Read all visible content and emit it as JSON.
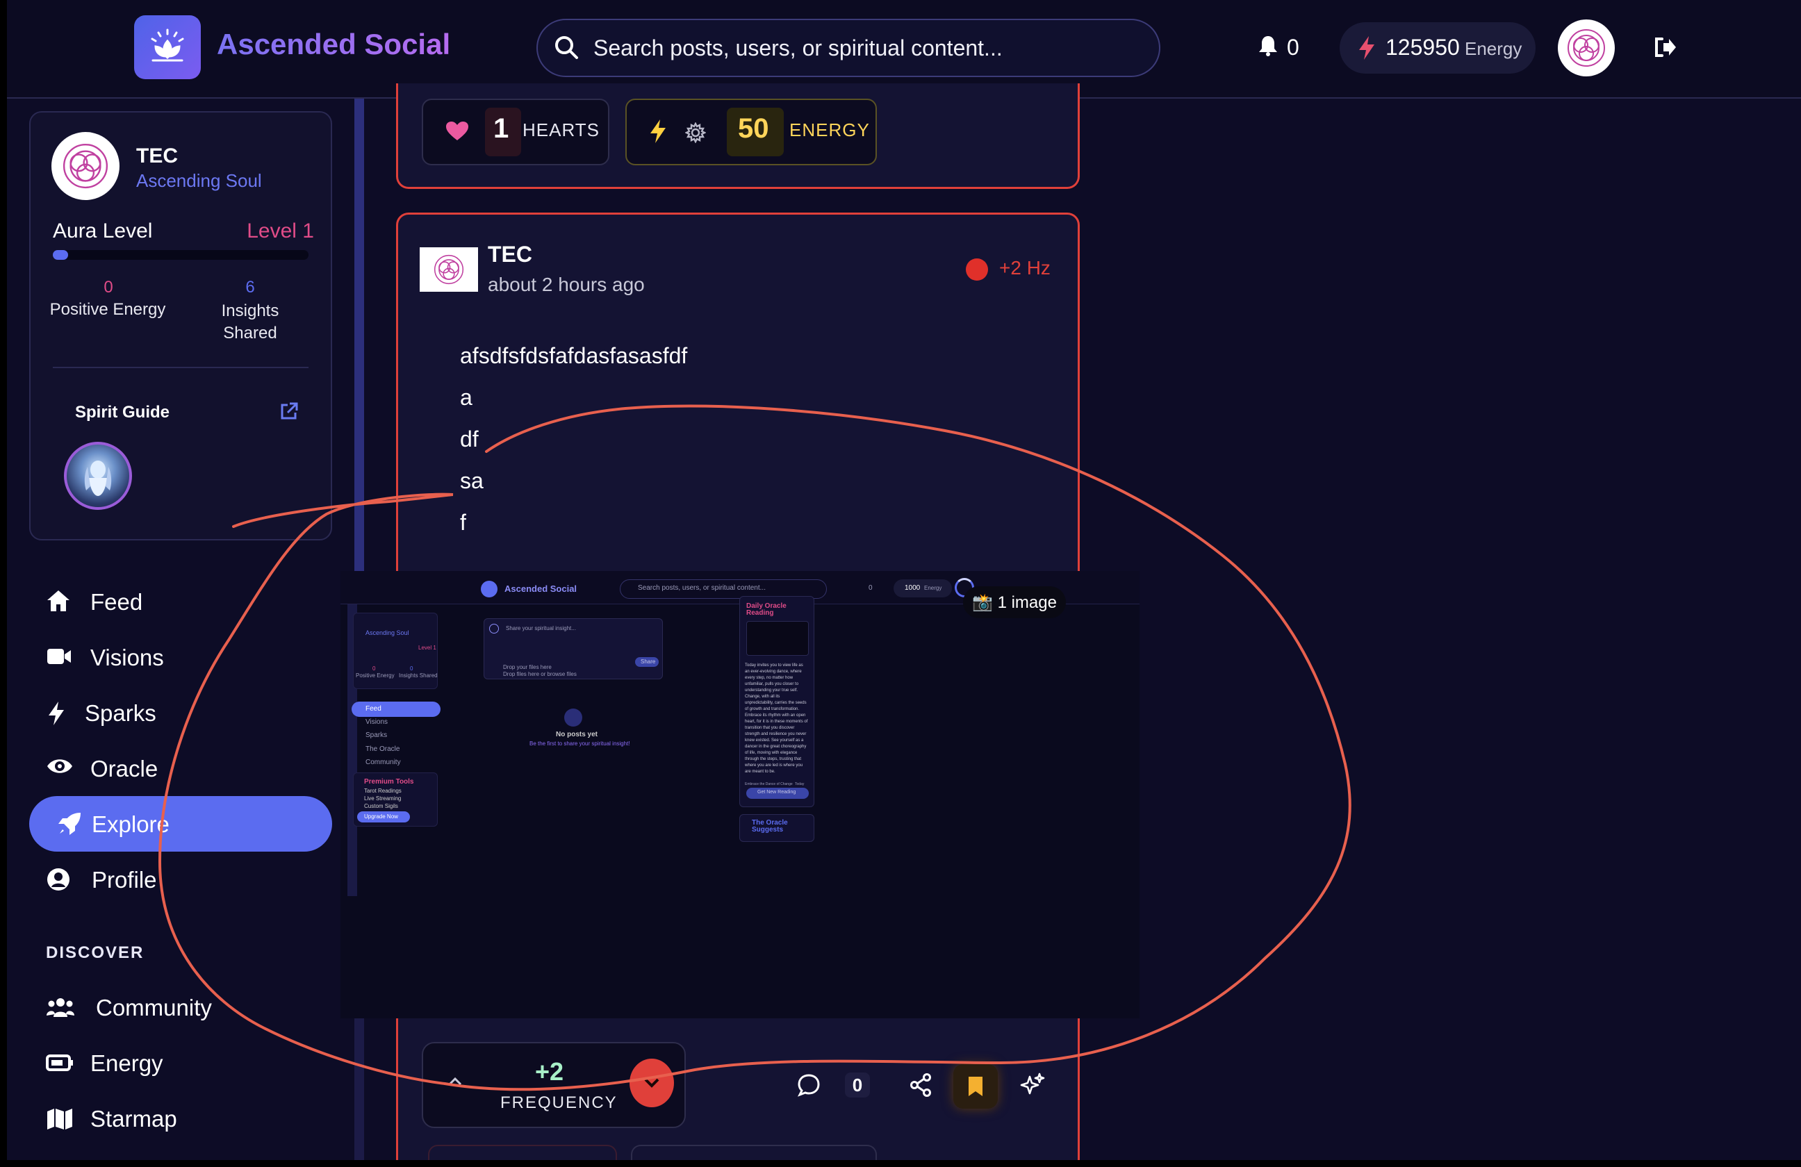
{
  "header": {
    "app_title": "Ascended Social",
    "search_placeholder": "Search posts, users, or spiritual content...",
    "notification_count": "0",
    "energy_balance": "125950",
    "energy_label": "Energy"
  },
  "profile": {
    "name": "TEC",
    "role": "Ascending Soul",
    "aura_label": "Aura Level",
    "aura_level": "Level 1",
    "aura_progress": 0.06,
    "positive_energy_value": "0",
    "positive_energy_label": "Positive Energy",
    "insights_value": "6",
    "insights_label": "Insights Shared",
    "spirit_guide_label": "Spirit Guide"
  },
  "nav": {
    "items": [
      {
        "label": "Feed",
        "icon": "home-icon"
      },
      {
        "label": "Visions",
        "icon": "video-icon"
      },
      {
        "label": "Sparks",
        "icon": "bolt-icon"
      },
      {
        "label": "Oracle",
        "icon": "eye-icon"
      },
      {
        "label": "Explore",
        "icon": "rocket-icon",
        "active": true
      },
      {
        "label": "Profile",
        "icon": "user-circle-icon"
      }
    ],
    "discover_label": "DISCOVER",
    "discover_items": [
      {
        "label": "Community",
        "icon": "users-icon"
      },
      {
        "label": "Energy",
        "icon": "battery-icon"
      },
      {
        "label": "Starmap",
        "icon": "map-icon"
      }
    ]
  },
  "post_prev": {
    "hearts_count": "1",
    "hearts_label": "HEARTS",
    "energy_count": "50",
    "energy_label": "ENERGY"
  },
  "post": {
    "author": "TEC",
    "time": "about 2 hours ago",
    "frequency_badge": "+2 Hz",
    "body_lines": [
      "afsdfsfdsfafdasfasasfdf",
      "a",
      "df",
      "sa",
      "f"
    ],
    "image_badge": "📸 1 image",
    "frequency_value": "+2",
    "frequency_label": "FREQUENCY",
    "comment_count": "0"
  },
  "embedded_screenshot": {
    "app_title": "Ascended Social",
    "search_placeholder": "Search posts, users, or spiritual content...",
    "notif": "0",
    "energy": "1000",
    "energy_label": "Energy",
    "profile_role": "Ascending Soul",
    "level": "Level 1",
    "pe_label": "Positive Energy",
    "is_label": "Insights Shared",
    "pe_val": "0",
    "is_val": "0",
    "nav": [
      "Feed",
      "Visions",
      "Sparks",
      "The Oracle",
      "Community"
    ],
    "premium_title": "Premium Tools",
    "premium_items": [
      "Tarot Readings",
      "Live Streaming",
      "Custom Sigils"
    ],
    "upgrade": "Upgrade Now",
    "composer_placeholder": "Share your spiritual insight...",
    "drop1": "Drop your files here",
    "drop2": "Drop files here or browse files",
    "share": "Share",
    "empty_title": "No posts yet",
    "empty_sub": "Be the first to share your spiritual insight!",
    "oracle_title": "Daily Oracle Reading",
    "oracle_text": "Today invites you to view life as an ever-evolving dance, where every step, no matter how unfamiliar, pulls you closer to understanding your true self. Change, with all its unpredictability, carries the seeds of growth and transformation. Embrace its rhythm with an open heart, for it is in these moments of transition that you discover strength and resilience you never knew existed. See yourself as a dancer in the great choreography of life, moving with elegance through the steps, trusting that where you are led is where you are meant to be.",
    "oracle_footer_left": "Embrace the Dance of Change",
    "oracle_footer_right": "Today",
    "oracle_button": "Get New Reading",
    "suggests": "The Oracle Suggests"
  },
  "colors": {
    "background": "#0d0c26",
    "accent": "#5b6cf0",
    "post_border": "#e0403a",
    "annotation": "#e8604e",
    "pink": "#e04c88"
  }
}
